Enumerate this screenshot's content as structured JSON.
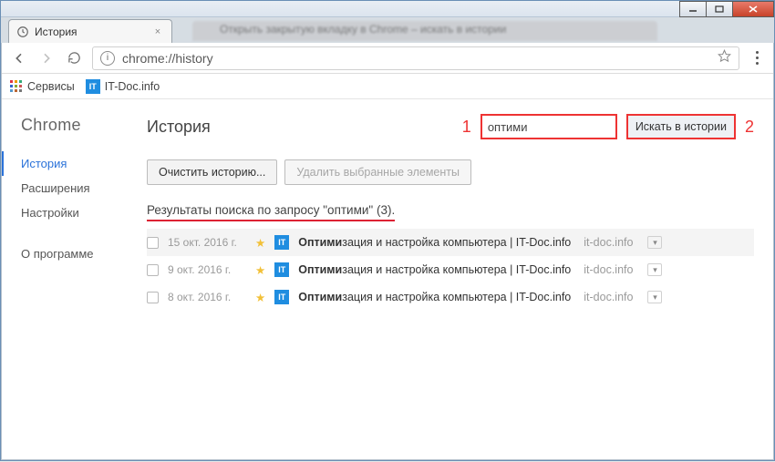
{
  "os_window": {
    "background_tab_ghost_text": "Открыть закрытую вкладку в Chrome – искать в истории"
  },
  "tab": {
    "title": "История"
  },
  "urlbar": {
    "text": "chrome://history"
  },
  "bookmarks": {
    "apps_label": "Сервисы",
    "items": [
      {
        "label": "IT-Doc.info"
      }
    ]
  },
  "sidebar": {
    "brand": "Chrome",
    "items": [
      {
        "label": "История",
        "active": true
      },
      {
        "label": "Расширения"
      },
      {
        "label": "Настройки"
      }
    ],
    "footer": {
      "label": "О программе"
    }
  },
  "history_page": {
    "title": "История",
    "search_value": "оптими",
    "search_button": "Искать в истории",
    "clear_button": "Очистить историю...",
    "delete_button": "Удалить выбранные элементы",
    "results_label": "Результаты поиска по запросу \"оптими\" (3).",
    "rows": [
      {
        "date": "15 окт. 2016 г.",
        "title_bold": "Оптими",
        "title_rest": "зация и настройка компьютера | IT-Doc.info",
        "domain": "it-doc.info"
      },
      {
        "date": "9 окт. 2016 г.",
        "title_bold": "Оптими",
        "title_rest": "зация и настройка компьютера | IT-Doc.info",
        "domain": "it-doc.info"
      },
      {
        "date": "8 окт. 2016 г.",
        "title_bold": "Оптими",
        "title_rest": "зация и настройка компьютера | IT-Doc.info",
        "domain": "it-doc.info"
      }
    ]
  },
  "annotations": {
    "one": "1",
    "two": "2"
  }
}
